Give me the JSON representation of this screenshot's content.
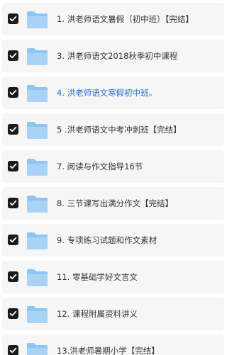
{
  "colors": {
    "row_background": "#f6f6f7",
    "checkbox": "#1a1a1a",
    "text": "#333333",
    "highlight_text": "#2a6bc9",
    "folder": "#8ec5f2"
  },
  "icons": {
    "checkbox": "checkbox-checked-icon",
    "folder": "folder-icon"
  },
  "items": [
    {
      "label": "1. 洪老师语文暑假（初中班）【完结】",
      "checked": true,
      "highlighted": false
    },
    {
      "label": "3. 洪老师语文2018秋季初中课程",
      "checked": true,
      "highlighted": false
    },
    {
      "label": "4. 洪老师语文寒假初中班。",
      "checked": true,
      "highlighted": true
    },
    {
      "label": "5 .洪老师语文中考冲刺班【完结】",
      "checked": true,
      "highlighted": false
    },
    {
      "label": "7. 阅读与作文指导16节",
      "checked": true,
      "highlighted": false
    },
    {
      "label": "8. 三节课写出满分作文【完结】",
      "checked": true,
      "highlighted": false
    },
    {
      "label": "9. 专项练习试题和作文素材",
      "checked": true,
      "highlighted": false
    },
    {
      "label": "11. 零基础学好文言文",
      "checked": true,
      "highlighted": false
    },
    {
      "label": "12. 课程附属资料讲义",
      "checked": true,
      "highlighted": false
    },
    {
      "label": "13.洪老师暑期小学【完结】",
      "checked": true,
      "highlighted": false
    }
  ]
}
